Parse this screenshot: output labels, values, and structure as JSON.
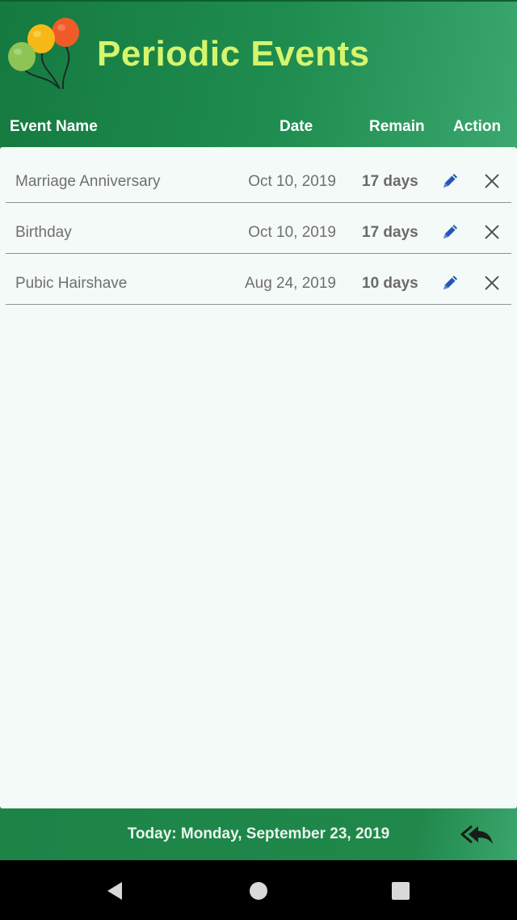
{
  "header": {
    "title": "Periodic Events",
    "logo_icon": "balloons-icon",
    "title_color": "#d6f56c"
  },
  "columns": {
    "name": "Event Name",
    "date": "Date",
    "remain": "Remain",
    "action": "Action"
  },
  "events": [
    {
      "name": "Marriage Anniversary",
      "date": "Oct 10, 2019",
      "remain": "17 days"
    },
    {
      "name": "Birthday",
      "date": "Oct 10, 2019",
      "remain": "17 days"
    },
    {
      "name": "Pubic Hairshave",
      "date": "Aug 24, 2019",
      "remain": "10 days"
    }
  ],
  "footer": {
    "today": "Today: Monday, September 23, 2019",
    "back_icon": "reply-all-icon"
  },
  "colors": {
    "primary_green": "#1f8a4c",
    "edit_icon": "#2456b8",
    "list_background": "#f4faf7"
  }
}
